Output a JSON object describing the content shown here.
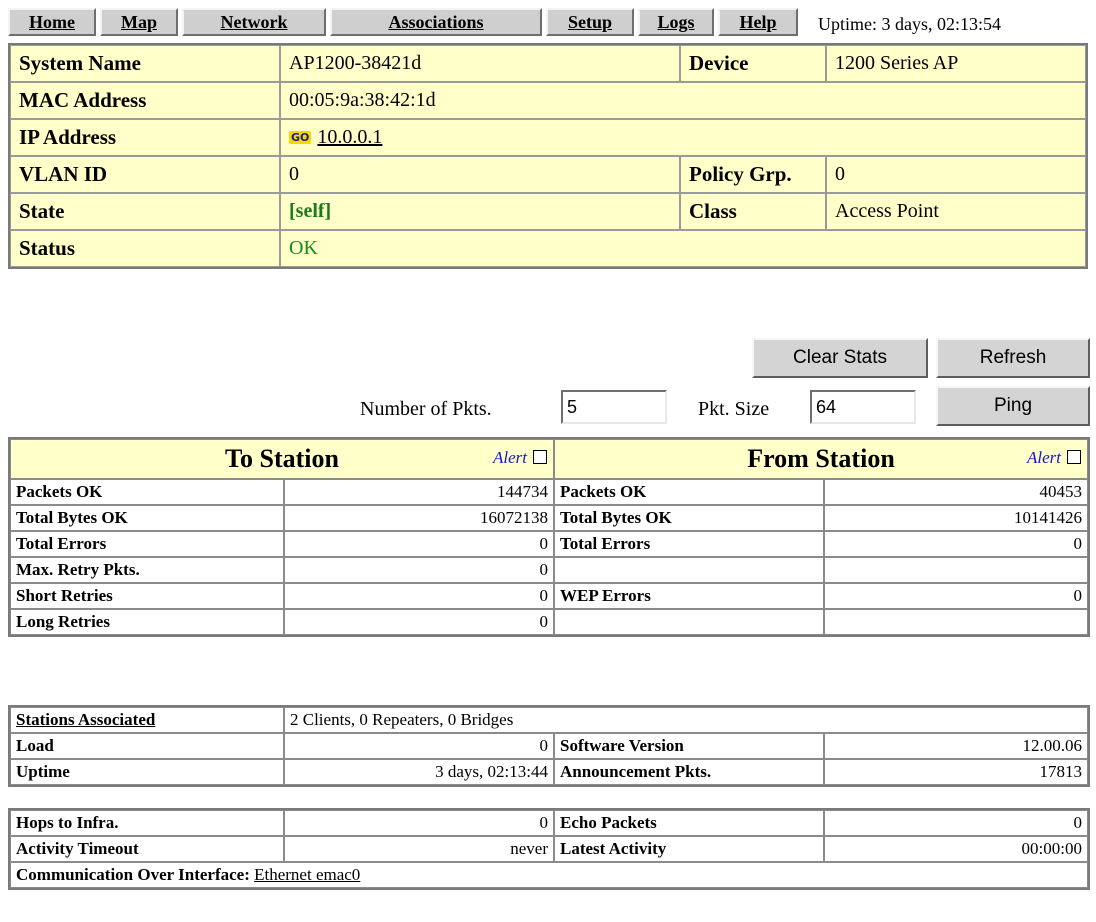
{
  "nav": {
    "home": "Home",
    "map": "Map",
    "network": "Network",
    "associations": "Associations",
    "setup": "Setup",
    "logs": "Logs",
    "help": "Help"
  },
  "uptime_header": "Uptime: 3 days, 02:13:54",
  "info": {
    "system_name_label": "System Name",
    "system_name": "AP1200-38421d",
    "device_label": "Device",
    "device": "1200 Series AP",
    "mac_label": "MAC Address",
    "mac": "00:05:9a:38:42:1d",
    "ip_label": "IP Address",
    "go_icon_text": "GO",
    "ip": "10.0.0.1",
    "vlan_label": "VLAN ID",
    "vlan": "0",
    "policy_label": "Policy Grp.",
    "policy": "0",
    "state_label": "State",
    "state": "[self]",
    "class_label": "Class",
    "class": "Access Point",
    "status_label": "Status",
    "status": "OK"
  },
  "actions": {
    "clear_stats": "Clear Stats",
    "refresh": "Refresh",
    "ping": "Ping",
    "num_pkts_label": "Number of Pkts.",
    "num_pkts_value": "5",
    "pkt_size_label": "Pkt. Size",
    "pkt_size_value": "64"
  },
  "stats": {
    "to_station": "To Station",
    "from_station": "From Station",
    "alert": "Alert",
    "rows": [
      {
        "to_label": "Packets OK",
        "to_value": "144734",
        "from_label": "Packets OK",
        "from_value": "40453"
      },
      {
        "to_label": "Total Bytes OK",
        "to_value": "16072138",
        "from_label": "Total Bytes OK",
        "from_value": "10141426"
      },
      {
        "to_label": "Total Errors",
        "to_value": "0",
        "from_label": "Total Errors",
        "from_value": "0"
      },
      {
        "to_label": "Max. Retry Pkts.",
        "to_value": "0",
        "from_label": "",
        "from_value": ""
      },
      {
        "to_label": "Short Retries",
        "to_value": "0",
        "from_label": "WEP Errors",
        "from_value": "0"
      },
      {
        "to_label": "Long Retries",
        "to_value": "0",
        "from_label": "",
        "from_value": ""
      }
    ]
  },
  "assoc": {
    "stations_label": "Stations Associated",
    "stations_value": "2 Clients, 0 Repeaters, 0 Bridges",
    "load_label": "Load",
    "load_value": "0",
    "sw_label": "Software Version",
    "sw_value": "12.00.06",
    "uptime_label": "Uptime",
    "uptime_value": "3 days, 02:13:44",
    "ann_label": "Announcement Pkts.",
    "ann_value": "17813"
  },
  "infra": {
    "hops_label": "Hops to Infra.",
    "hops_value": "0",
    "echo_label": "Echo Packets",
    "echo_value": "0",
    "activity_label": "Activity Timeout",
    "activity_value": "never",
    "latest_label": "Latest Activity",
    "latest_value": "00:00:00",
    "comm_label": "Communication Over Interface:",
    "comm_value": "Ethernet emac0"
  }
}
